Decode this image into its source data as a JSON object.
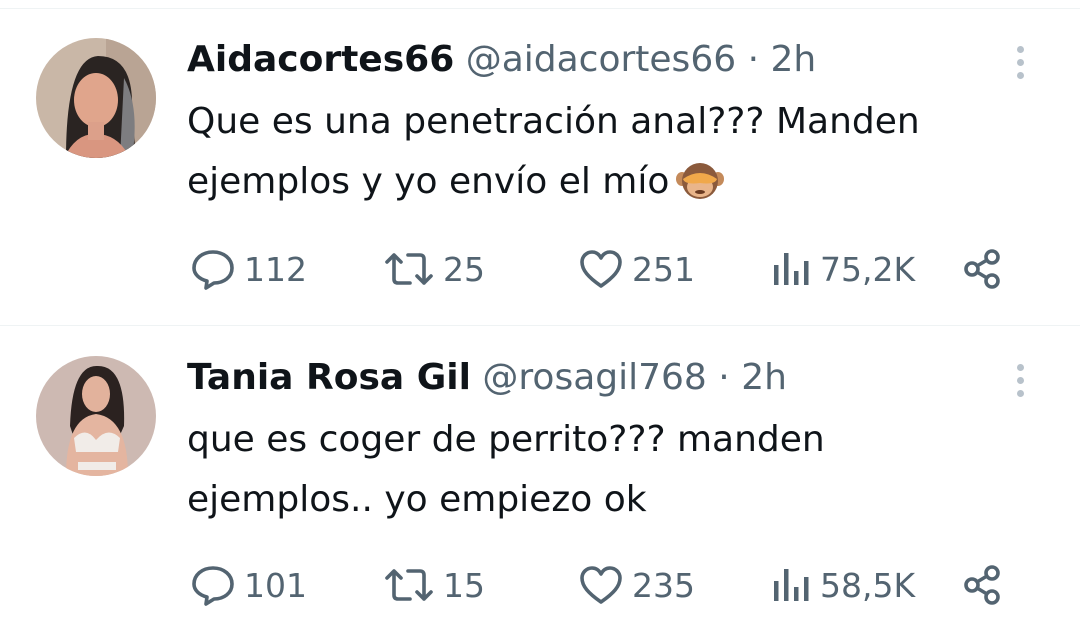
{
  "tweets": [
    {
      "name": "Aidacortes66",
      "handle": "@aidacortes66",
      "separator": "·",
      "time": "2h",
      "text_line1": "Que es una penetración anal??? Manden",
      "text_line2": "ejemplos y yo envío el mío",
      "emoji": "see-no-evil-monkey",
      "replies": "112",
      "reposts": "25",
      "likes": "251",
      "views": "75,2K"
    },
    {
      "name": "Tania Rosa Gil",
      "handle": "@rosagil768",
      "separator": "·",
      "time": "2h",
      "text_line1": "que es coger de perrito??? manden",
      "text_line2": "ejemplos.. yo empiezo ok",
      "replies": "101",
      "reposts": "15",
      "likes": "235",
      "views": "58,5K"
    }
  ],
  "icons": [
    "reply-icon",
    "repost-icon",
    "like-icon",
    "views-icon",
    "share-icon",
    "more-options-icon"
  ],
  "colors": {
    "text": "#0f1419",
    "secondary": "#536471",
    "divider": "#eff3f4"
  }
}
